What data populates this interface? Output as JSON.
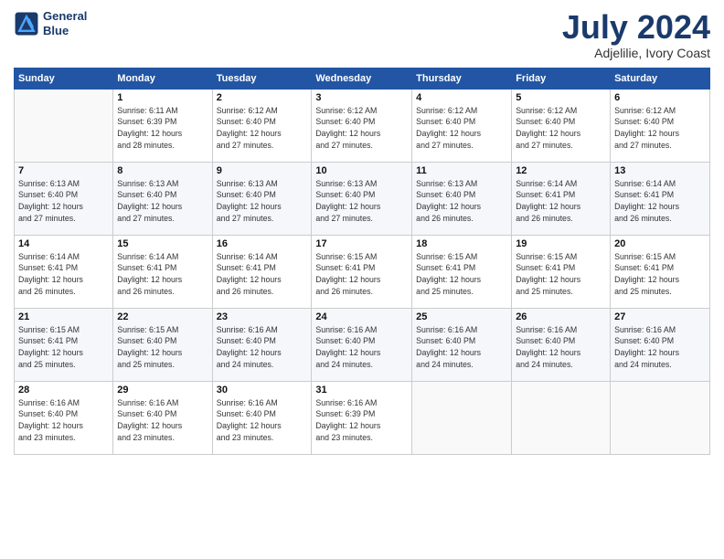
{
  "logo": {
    "line1": "General",
    "line2": "Blue"
  },
  "title": "July 2024",
  "subtitle": "Adjelilie, Ivory Coast",
  "weekdays": [
    "Sunday",
    "Monday",
    "Tuesday",
    "Wednesday",
    "Thursday",
    "Friday",
    "Saturday"
  ],
  "weeks": [
    [
      {
        "day": "",
        "info": ""
      },
      {
        "day": "1",
        "info": "Sunrise: 6:11 AM\nSunset: 6:39 PM\nDaylight: 12 hours\nand 28 minutes."
      },
      {
        "day": "2",
        "info": "Sunrise: 6:12 AM\nSunset: 6:40 PM\nDaylight: 12 hours\nand 27 minutes."
      },
      {
        "day": "3",
        "info": "Sunrise: 6:12 AM\nSunset: 6:40 PM\nDaylight: 12 hours\nand 27 minutes."
      },
      {
        "day": "4",
        "info": "Sunrise: 6:12 AM\nSunset: 6:40 PM\nDaylight: 12 hours\nand 27 minutes."
      },
      {
        "day": "5",
        "info": "Sunrise: 6:12 AM\nSunset: 6:40 PM\nDaylight: 12 hours\nand 27 minutes."
      },
      {
        "day": "6",
        "info": "Sunrise: 6:12 AM\nSunset: 6:40 PM\nDaylight: 12 hours\nand 27 minutes."
      }
    ],
    [
      {
        "day": "7",
        "info": "Sunrise: 6:13 AM\nSunset: 6:40 PM\nDaylight: 12 hours\nand 27 minutes."
      },
      {
        "day": "8",
        "info": "Sunrise: 6:13 AM\nSunset: 6:40 PM\nDaylight: 12 hours\nand 27 minutes."
      },
      {
        "day": "9",
        "info": "Sunrise: 6:13 AM\nSunset: 6:40 PM\nDaylight: 12 hours\nand 27 minutes."
      },
      {
        "day": "10",
        "info": "Sunrise: 6:13 AM\nSunset: 6:40 PM\nDaylight: 12 hours\nand 27 minutes."
      },
      {
        "day": "11",
        "info": "Sunrise: 6:13 AM\nSunset: 6:40 PM\nDaylight: 12 hours\nand 26 minutes."
      },
      {
        "day": "12",
        "info": "Sunrise: 6:14 AM\nSunset: 6:41 PM\nDaylight: 12 hours\nand 26 minutes."
      },
      {
        "day": "13",
        "info": "Sunrise: 6:14 AM\nSunset: 6:41 PM\nDaylight: 12 hours\nand 26 minutes."
      }
    ],
    [
      {
        "day": "14",
        "info": "Sunrise: 6:14 AM\nSunset: 6:41 PM\nDaylight: 12 hours\nand 26 minutes."
      },
      {
        "day": "15",
        "info": "Sunrise: 6:14 AM\nSunset: 6:41 PM\nDaylight: 12 hours\nand 26 minutes."
      },
      {
        "day": "16",
        "info": "Sunrise: 6:14 AM\nSunset: 6:41 PM\nDaylight: 12 hours\nand 26 minutes."
      },
      {
        "day": "17",
        "info": "Sunrise: 6:15 AM\nSunset: 6:41 PM\nDaylight: 12 hours\nand 26 minutes."
      },
      {
        "day": "18",
        "info": "Sunrise: 6:15 AM\nSunset: 6:41 PM\nDaylight: 12 hours\nand 25 minutes."
      },
      {
        "day": "19",
        "info": "Sunrise: 6:15 AM\nSunset: 6:41 PM\nDaylight: 12 hours\nand 25 minutes."
      },
      {
        "day": "20",
        "info": "Sunrise: 6:15 AM\nSunset: 6:41 PM\nDaylight: 12 hours\nand 25 minutes."
      }
    ],
    [
      {
        "day": "21",
        "info": "Sunrise: 6:15 AM\nSunset: 6:41 PM\nDaylight: 12 hours\nand 25 minutes."
      },
      {
        "day": "22",
        "info": "Sunrise: 6:15 AM\nSunset: 6:40 PM\nDaylight: 12 hours\nand 25 minutes."
      },
      {
        "day": "23",
        "info": "Sunrise: 6:16 AM\nSunset: 6:40 PM\nDaylight: 12 hours\nand 24 minutes."
      },
      {
        "day": "24",
        "info": "Sunrise: 6:16 AM\nSunset: 6:40 PM\nDaylight: 12 hours\nand 24 minutes."
      },
      {
        "day": "25",
        "info": "Sunrise: 6:16 AM\nSunset: 6:40 PM\nDaylight: 12 hours\nand 24 minutes."
      },
      {
        "day": "26",
        "info": "Sunrise: 6:16 AM\nSunset: 6:40 PM\nDaylight: 12 hours\nand 24 minutes."
      },
      {
        "day": "27",
        "info": "Sunrise: 6:16 AM\nSunset: 6:40 PM\nDaylight: 12 hours\nand 24 minutes."
      }
    ],
    [
      {
        "day": "28",
        "info": "Sunrise: 6:16 AM\nSunset: 6:40 PM\nDaylight: 12 hours\nand 23 minutes."
      },
      {
        "day": "29",
        "info": "Sunrise: 6:16 AM\nSunset: 6:40 PM\nDaylight: 12 hours\nand 23 minutes."
      },
      {
        "day": "30",
        "info": "Sunrise: 6:16 AM\nSunset: 6:40 PM\nDaylight: 12 hours\nand 23 minutes."
      },
      {
        "day": "31",
        "info": "Sunrise: 6:16 AM\nSunset: 6:39 PM\nDaylight: 12 hours\nand 23 minutes."
      },
      {
        "day": "",
        "info": ""
      },
      {
        "day": "",
        "info": ""
      },
      {
        "day": "",
        "info": ""
      }
    ]
  ]
}
